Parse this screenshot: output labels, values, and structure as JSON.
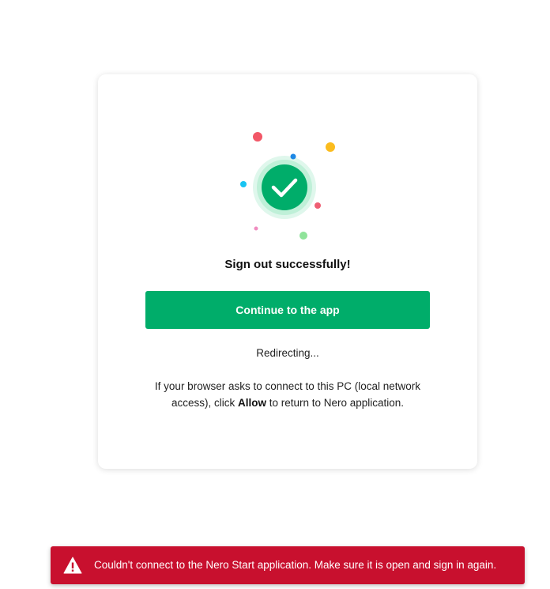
{
  "card": {
    "title": "Sign out successfully!",
    "continue_label": "Continue to the app",
    "redirecting": "Redirecting...",
    "note": {
      "before": "If your browser asks to connect to this PC (local network access), click ",
      "bold": "Allow",
      "after": " to return to Nero application."
    }
  },
  "illustration": {
    "icon": "check-circle-icon",
    "colors": {
      "check_fill": "#00ad6a",
      "halo": "#bff0d8",
      "confetti": [
        "#f25767",
        "#1e88e5",
        "#fbbc1e",
        "#18c4f2",
        "#ee5f73",
        "#f08cc0",
        "#8fe39a"
      ]
    }
  },
  "toast": {
    "icon": "warning-icon",
    "message": "Couldn't connect to the Nero Start application. Make sure it is open and sign in again.",
    "color": "#c8102e"
  }
}
